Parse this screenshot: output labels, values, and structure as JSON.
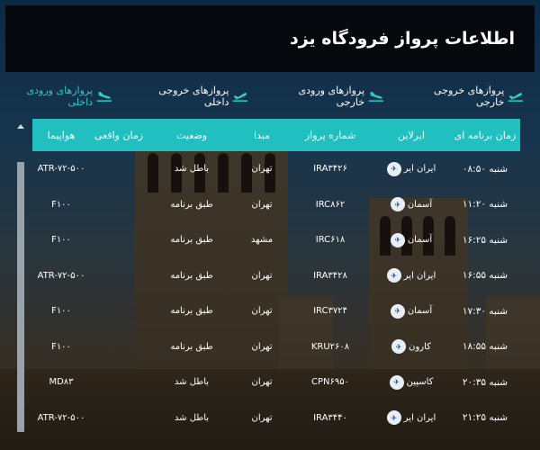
{
  "header": {
    "title": "اطلاعات پرواز فرودگاه یزد"
  },
  "tabs": [
    {
      "label": "پروازهای ورودی داخلی",
      "active": true,
      "icon": "plane-landing-icon"
    },
    {
      "label": "پروازهای خروجی داخلی",
      "active": false,
      "icon": "plane-takeoff-icon"
    },
    {
      "label": "پروازهای ورودی خارجی",
      "active": false,
      "icon": "plane-landing-icon"
    },
    {
      "label": "پروازهای خروجی خارجی",
      "active": false,
      "icon": "plane-takeoff-icon"
    }
  ],
  "table": {
    "columns": [
      "زمان برنامه ای",
      "ایرلاین",
      "شماره پرواز",
      "مبدا",
      "وضعیت",
      "زمان واقعی",
      "هواپیما"
    ],
    "rows": [
      {
        "time": "شنبه ۰۸:۵۰",
        "airline": "ایران ایر",
        "flight": "IRA۳۴۲۶",
        "origin": "تهران",
        "status": "باطل شد",
        "actual": "",
        "aircraft": "ATR-۷۲-۵۰۰"
      },
      {
        "time": "شنبه ۱۱:۲۰",
        "airline": "آسمان",
        "flight": "IRC۸۶۲",
        "origin": "تهران",
        "status": "طبق برنامه",
        "actual": "",
        "aircraft": "F۱۰۰"
      },
      {
        "time": "شنبه ۱۶:۲۵",
        "airline": "آسمان",
        "flight": "IRC۶۱۸",
        "origin": "مشهد",
        "status": "طبق برنامه",
        "actual": "",
        "aircraft": "F۱۰۰"
      },
      {
        "time": "شنبه ۱۶:۵۵",
        "airline": "ایران ایر",
        "flight": "IRA۳۴۲۸",
        "origin": "تهران",
        "status": "طبق برنامه",
        "actual": "",
        "aircraft": "ATR-۷۲-۵۰۰"
      },
      {
        "time": "شنبه ۱۷:۳۰",
        "airline": "آسمان",
        "flight": "IRC۳۷۲۴",
        "origin": "تهران",
        "status": "طبق برنامه",
        "actual": "",
        "aircraft": "F۱۰۰"
      },
      {
        "time": "شنبه ۱۸:۵۵",
        "airline": "کارون",
        "flight": "KRU۲۶۰۸",
        "origin": "تهران",
        "status": "طبق برنامه",
        "actual": "",
        "aircraft": "F۱۰۰"
      },
      {
        "time": "شنبه ۲۰:۳۵",
        "airline": "کاسپین",
        "flight": "CPN۶۹۵۰",
        "origin": "تهران",
        "status": "باطل شد",
        "actual": "",
        "aircraft": "MD۸۳"
      },
      {
        "time": "شنبه ۲۱:۲۵",
        "airline": "ایران ایر",
        "flight": "IRA۳۴۴۰",
        "origin": "تهران",
        "status": "باطل شد",
        "actual": "",
        "aircraft": "ATR-۷۲-۵۰۰"
      }
    ]
  },
  "colors": {
    "accent": "#21bfbf",
    "header_bg": "#05080d"
  }
}
